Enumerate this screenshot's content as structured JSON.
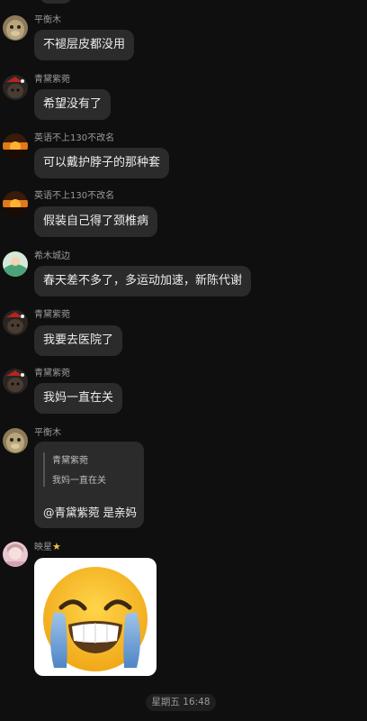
{
  "messages": [
    {
      "sender": "平衡木",
      "text": "不褪层皮都没用",
      "avatar": "monkey-avatar"
    },
    {
      "sender": "青黛紫菀",
      "text": "希望没有了",
      "avatar": "dark-cat-avatar"
    },
    {
      "sender": "英语不上130不改名",
      "text": "可以戴护脖子的那种套",
      "avatar": "sunset-avatar"
    },
    {
      "sender": "英语不上130不改名",
      "text": "假装自己得了颈椎病",
      "avatar": "sunset-avatar"
    },
    {
      "sender": "希木城边",
      "text": "春天差不多了，多运动加速，新陈代谢",
      "avatar": "cartoon-avatar"
    },
    {
      "sender": "青黛紫菀",
      "text": "我要去医院了",
      "avatar": "dark-cat-avatar"
    },
    {
      "sender": "青黛紫菀",
      "text": "我妈一直在关",
      "avatar": "dark-cat-avatar"
    }
  ],
  "quote_message": {
    "sender": "平衡木",
    "quoted_sender": "青黛紫菀",
    "quoted_text": "我妈一直在关",
    "reply": "@青黛紫菀 是亲妈"
  },
  "sticker_message": {
    "sender": "映星",
    "sticker": "crying-laughing-emoji-sticker"
  },
  "timestamp": "星期五 16:48"
}
